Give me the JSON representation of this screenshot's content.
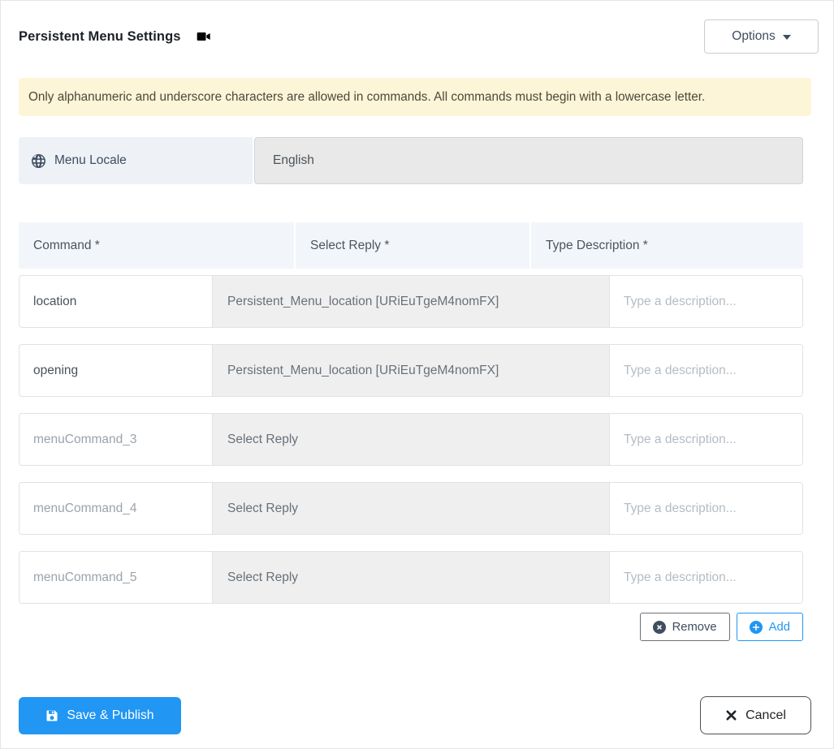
{
  "header": {
    "title": "Persistent Menu Settings",
    "title_icon": "videocam-icon",
    "options_label": "Options",
    "options_caret_icon": "caret-down-icon"
  },
  "alert": {
    "text": "Only alphanumeric and underscore characters are allowed in commands. All commands must begin with a lowercase letter."
  },
  "locale": {
    "icon": "globe-icon",
    "label": "Menu Locale",
    "value": "English"
  },
  "table": {
    "columns": [
      "Command *",
      "Select Reply *",
      "Type Description *"
    ],
    "description_placeholder": "Type a description...",
    "rows": [
      {
        "command": "location",
        "command_is_placeholder": false,
        "reply": "Persistent_Menu_location [URiEuTgeM4nomFX]"
      },
      {
        "command": "opening",
        "command_is_placeholder": false,
        "reply": "Persistent_Menu_location [URiEuTgeM4nomFX]"
      },
      {
        "command": "menuCommand_3",
        "command_is_placeholder": true,
        "reply": "Select Reply"
      },
      {
        "command": "menuCommand_4",
        "command_is_placeholder": true,
        "reply": "Select Reply"
      },
      {
        "command": "menuCommand_5",
        "command_is_placeholder": true,
        "reply": "Select Reply"
      }
    ],
    "actions": {
      "remove_label": "Remove",
      "remove_icon": "circle-x-icon",
      "add_label": "Add",
      "add_icon": "circle-plus-icon"
    }
  },
  "footer": {
    "save_label": "Save & Publish",
    "save_icon": "floppy-save-icon",
    "cancel_label": "Cancel",
    "cancel_icon": "x-icon"
  },
  "colors": {
    "accent_blue": "#2196f3",
    "alert_bg": "#fdf5d8",
    "slate_text": "#3f4d5f",
    "reply_cell_bg": "#efefef",
    "header_row_bg": "#f2f6fa",
    "locale_label_bg": "#eef1f6",
    "locale_value_bg": "#e9e9e9"
  }
}
